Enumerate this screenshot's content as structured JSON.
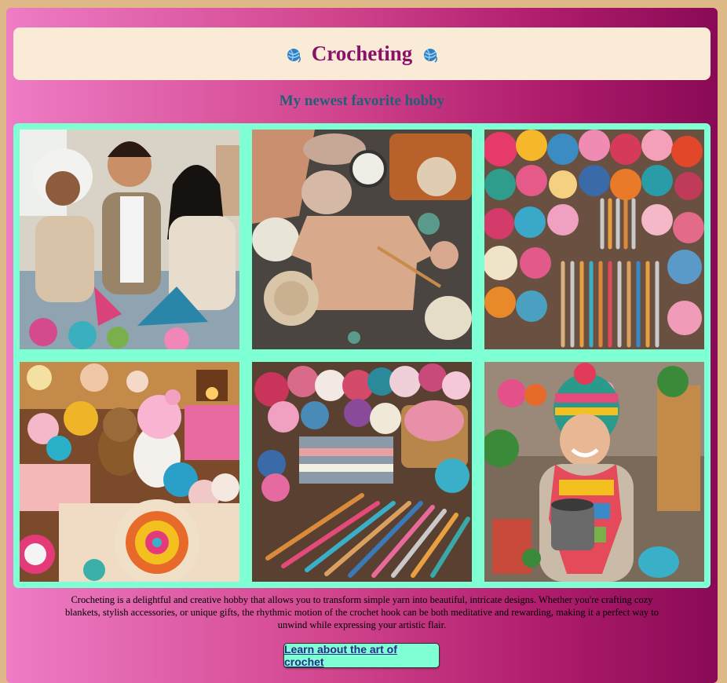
{
  "header": {
    "title": "Crocheting",
    "left_icon": "yarn-ball-icon",
    "right_icon": "yarn-ball-icon"
  },
  "subtitle": "My newest favorite hobby",
  "gallery": {
    "images": [
      {
        "name": "family-knitting-photo"
      },
      {
        "name": "crochet-sweater-flatlay-photo"
      },
      {
        "name": "yarn-and-hooks-photo"
      },
      {
        "name": "crochet-toys-photo"
      },
      {
        "name": "yarn-basket-hooks-photo"
      },
      {
        "name": "woman-crochet-hat-scarf-photo"
      }
    ]
  },
  "description": "Crocheting is a delightful and creative hobby that allows you to transform simple yarn into beautiful, intricate designs. Whether you're crafting cozy blankets, stylish accessories, or unique gifts, the rhythmic motion of the crochet hook can be both meditative and rewarding, making it a perfect way to unwind while expressing your artistic flair.",
  "cta": {
    "label": "Learn about the art of crochet"
  },
  "colors": {
    "background": "#deb887",
    "gradient_start": "#ee7cc4",
    "gradient_end": "#8a0a55",
    "header_bg": "#faebd7",
    "title": "#8b1168",
    "subtitle": "#1f6078",
    "gallery_bg": "#7fffd4",
    "button_bg": "#7fffd4"
  }
}
